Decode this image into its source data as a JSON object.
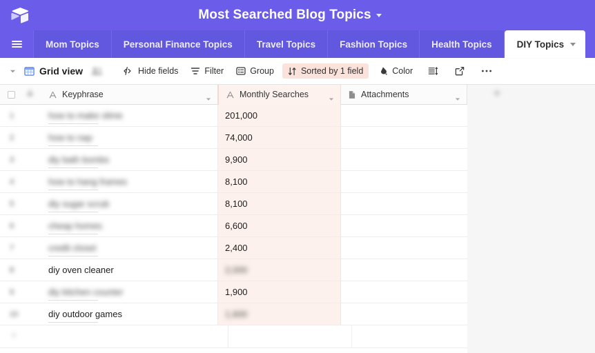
{
  "topbar": {
    "logo_icon": "airtable-cube-icon",
    "base_title": "Most Searched Blog Topics",
    "base_title_caret": "chevron-down-icon"
  },
  "tabbar": {
    "menu_icon": "hamburger-menu-icon",
    "tabs": [
      {
        "label": "Mom Topics",
        "active": false
      },
      {
        "label": "Personal Finance Topics",
        "active": false
      },
      {
        "label": "Travel Topics",
        "active": false
      },
      {
        "label": "Fashion Topics",
        "active": false
      },
      {
        "label": "Health Topics",
        "active": false
      },
      {
        "label": "DIY Topics",
        "active": true
      }
    ],
    "active_tab_caret": "chevron-down-icon"
  },
  "toolbar": {
    "view_caret_icon": "chevron-down-icon",
    "grid_icon": "grid-view-icon",
    "view_name": "Grid view",
    "collaborators_icon": "collaborators-icon",
    "hide_fields_icon": "hide-fields-icon",
    "hide_fields_label": "Hide fields",
    "filter_icon": "filter-icon",
    "filter_label": "Filter",
    "group_icon": "group-icon",
    "group_label": "Group",
    "sort_icon": "sort-icon",
    "sort_label": "Sorted by 1 field",
    "sort_pill_color": "#FBE2DA",
    "color_icon": "color-palette-icon",
    "color_label": "Color",
    "row_height_icon": "row-height-icon",
    "share_icon": "share-export-icon",
    "more_icon": "more-options-icon"
  },
  "grid": {
    "select_all_icon": "checkbox-unchecked-icon",
    "lock_icon": "lock-icon",
    "add_field_icon": "add-field-plus-icon",
    "columns": [
      {
        "name": "Keyphrase",
        "type_icon": "text-field-icon",
        "caret": "chevron-down-icon"
      },
      {
        "name": "Monthly Searches",
        "type_icon": "text-field-icon",
        "caret": "chevron-down-icon",
        "highlighted": true
      },
      {
        "name": "Attachments",
        "type_icon": "attachment-field-icon",
        "caret": "chevron-down-icon"
      }
    ],
    "rows": [
      {
        "num": "1",
        "keyphrase": "how to make slime",
        "keyphrase_blurred": true,
        "searches": "201,000",
        "searches_blurred": false
      },
      {
        "num": "2",
        "keyphrase": "how to nap",
        "keyphrase_blurred": true,
        "searches": "74,000",
        "searches_blurred": false
      },
      {
        "num": "3",
        "keyphrase": "diy bath bombs",
        "keyphrase_blurred": true,
        "searches": "9,900",
        "searches_blurred": false
      },
      {
        "num": "4",
        "keyphrase": "how to hang frames",
        "keyphrase_blurred": true,
        "searches": "8,100",
        "searches_blurred": false
      },
      {
        "num": "5",
        "keyphrase": "diy sugar scrub",
        "keyphrase_blurred": true,
        "searches": "8,100",
        "searches_blurred": false
      },
      {
        "num": "6",
        "keyphrase": "cheap homes",
        "keyphrase_blurred": true,
        "searches": "6,600",
        "searches_blurred": false
      },
      {
        "num": "7",
        "keyphrase": "credit closet",
        "keyphrase_blurred": true,
        "searches": "2,400",
        "searches_blurred": false
      },
      {
        "num": "8",
        "keyphrase": "diy oven cleaner",
        "keyphrase_blurred": false,
        "searches": "2,000",
        "searches_blurred": true
      },
      {
        "num": "9",
        "keyphrase": "diy kitchen counter",
        "keyphrase_blurred": true,
        "searches": "1,900",
        "searches_blurred": false
      },
      {
        "num": "10",
        "keyphrase": "diy outdoor games",
        "keyphrase_blurred": false,
        "searches": "1,600",
        "searches_blurred": true
      }
    ]
  },
  "colors": {
    "brand_purple": "#6B5DEA",
    "tab_purple": "#6257DF",
    "highlight_peach": "#FDF1ED",
    "sort_pill": "#FBE2DA"
  }
}
